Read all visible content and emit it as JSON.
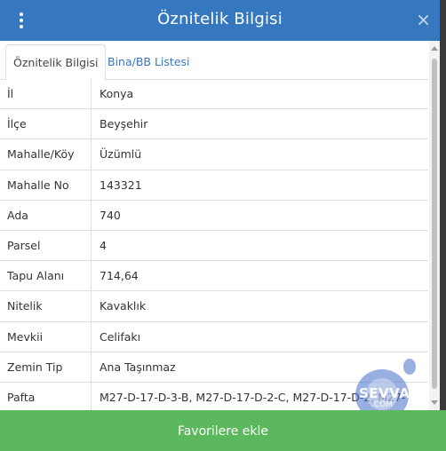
{
  "header": {
    "title": "Öznitelik Bilgisi",
    "close_glyph": "×",
    "menu_icon": "kebab-menu-icon"
  },
  "tabs": [
    {
      "label": "Öznitelik Bilgisi",
      "active": true
    },
    {
      "label": "Bina/BB Listesi",
      "active": false
    }
  ],
  "attributes": [
    {
      "key": "İl",
      "value": "Konya"
    },
    {
      "key": "İlçe",
      "value": "Beyşehir"
    },
    {
      "key": "Mahalle/Köy",
      "value": "Üzümlü"
    },
    {
      "key": "Mahalle No",
      "value": "143321"
    },
    {
      "key": "Ada",
      "value": "740"
    },
    {
      "key": "Parsel",
      "value": "4"
    },
    {
      "key": "Tapu Alanı",
      "value": "714,64"
    },
    {
      "key": "Nitelik",
      "value": "Kavaklık"
    },
    {
      "key": "Mevkii",
      "value": "Celifakı"
    },
    {
      "key": "Zemin Tip",
      "value": "Ana Taşınmaz"
    },
    {
      "key": "Pafta",
      "value": "M27-D-17-D-3-B, M27-D-17-D-2-C, M27-D-17-D-2, M27-"
    }
  ],
  "footer": {
    "label": "Favorilere ekle"
  },
  "watermark": {
    "brand": "SEVVAL",
    "sub": ".COM"
  },
  "colors": {
    "header": "#3678c0",
    "footer": "#5cb85c",
    "link": "#3678c0"
  }
}
